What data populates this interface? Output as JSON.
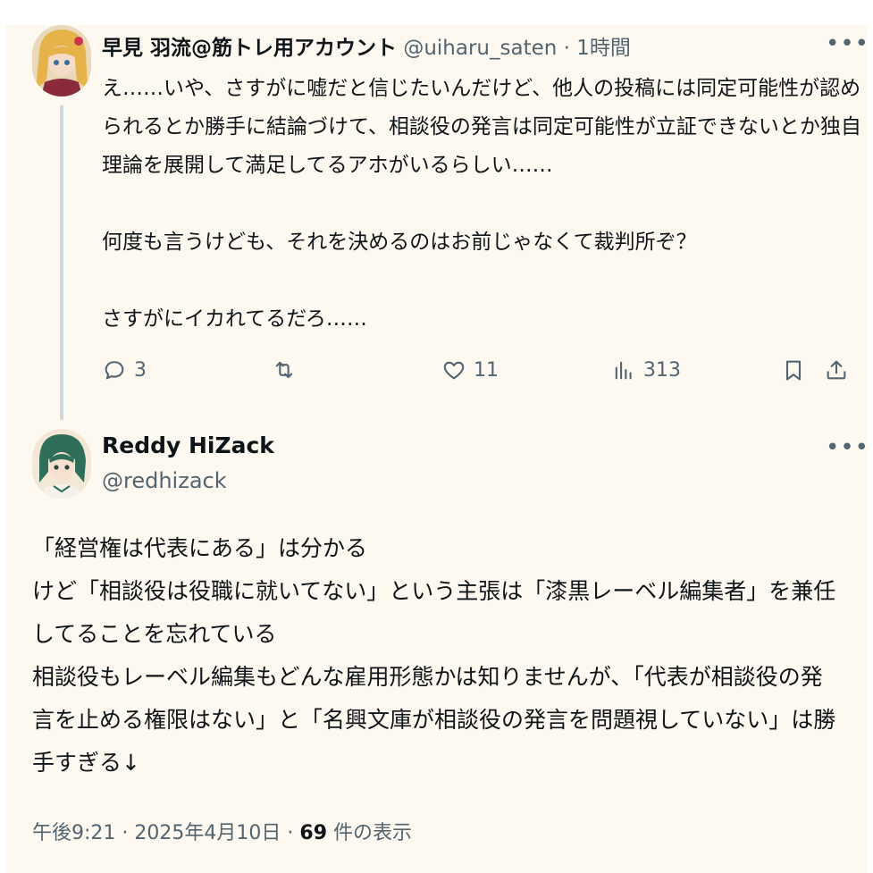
{
  "reply_tweet": {
    "display_name": "早見 羽流@筋トレ用アカウント",
    "handle": "@uiharu_saten",
    "separator": "·",
    "time": "1時間",
    "text_lines": [
      "え……いや、さすがに嘘だと信じたいんだけど、他人の投稿には同定可能性が認め",
      "られるとか勝手に結論づけて、相談役の発言は同定可能性が立証できないとか独自",
      "理論を展開して満足してるアホがいるらしい……",
      "",
      "何度も言うけども、それを決めるのはお前じゃなくて裁判所ぞ？",
      "",
      "さすがにイカれてるだろ……"
    ],
    "actions": {
      "reply_count": "3",
      "repost_count": "",
      "like_count": "11",
      "views_count": "313"
    }
  },
  "main_tweet": {
    "display_name": "Reddy HiZack",
    "handle": "@redhizack",
    "text_lines": [
      "「経営権は代表にある」は分かる",
      "けど「相談役は役職に就いてない」という主張は「漆黒レーベル編集者」を兼任",
      "してることを忘れている",
      "相談役もレーベル編集もどんな雇用形態かは知りませんが、「代表が相談役の発",
      "言を止める権限はない」と「名興文庫が相談役の発言を問題視していない」は勝",
      "手すぎる↓"
    ],
    "footer": {
      "time": "午後9:21",
      "date": "2025年4月10日",
      "sep1": "·",
      "sep2": "·",
      "views_number": "69",
      "views_label": "件の表示"
    }
  },
  "icons": [
    "more-icon",
    "reply-icon",
    "repost-icon",
    "like-icon",
    "views-icon",
    "bookmark-icon",
    "share-icon"
  ],
  "colors": {
    "background": "#fef9f0",
    "text": "#0f1419",
    "secondary": "#536471",
    "thread_line": "#cfd9de"
  }
}
